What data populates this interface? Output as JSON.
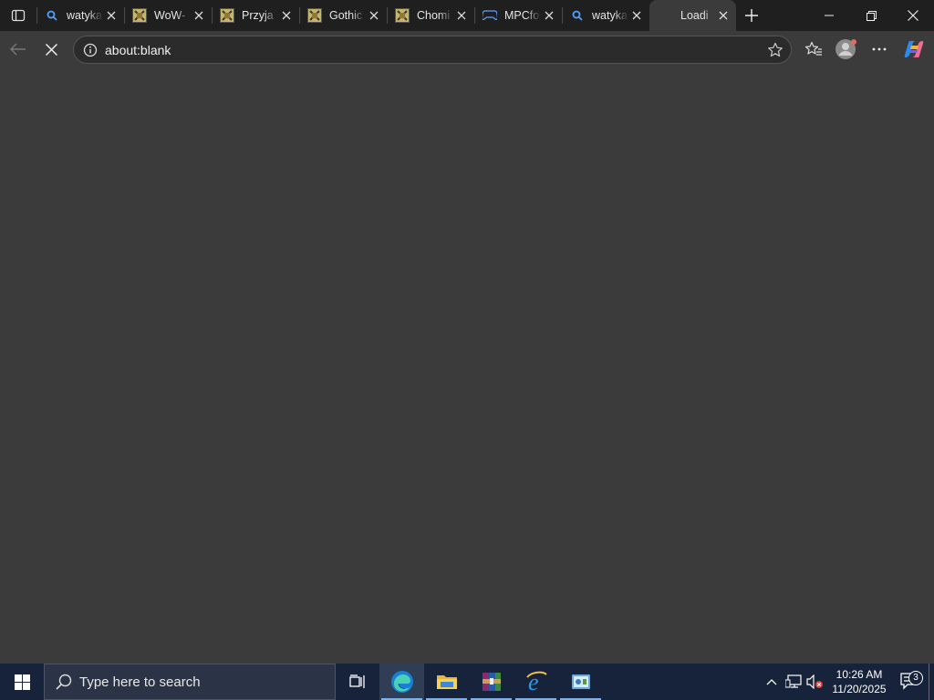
{
  "browser": {
    "tabs": [
      {
        "title": "watyka",
        "icon": "search-icon"
      },
      {
        "title": "WoW-",
        "icon": "site-favicon"
      },
      {
        "title": "Przyja",
        "icon": "site-favicon"
      },
      {
        "title": "Gothic",
        "icon": "site-favicon"
      },
      {
        "title": "Chomi",
        "icon": "site-favicon"
      },
      {
        "title": "MPCfo",
        "icon": "gamepad-icon"
      },
      {
        "title": "watyka",
        "icon": "search-icon"
      },
      {
        "title": "Loadi",
        "icon": "none",
        "active": true
      }
    ],
    "address_bar": {
      "url": "about:blank"
    }
  },
  "taskbar": {
    "search_placeholder": "Type here to search",
    "apps": [
      "edge",
      "file-explorer",
      "winrar",
      "internet-explorer",
      "control-panel"
    ],
    "clock": {
      "time": "10:26 AM",
      "date": "11/20/2025"
    },
    "notification_count": "3"
  },
  "colors": {
    "tabbar": "#1f1f1f",
    "toolbar": "#3b3b3b",
    "taskbar": "#16233a"
  }
}
